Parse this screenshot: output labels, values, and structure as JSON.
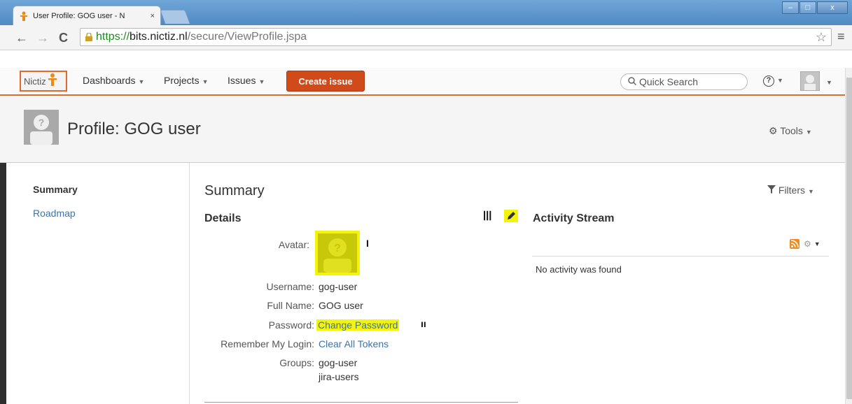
{
  "browser": {
    "tab_title": "User Profile: GOG user - N",
    "tab_close": "×",
    "url_scheme": "https://",
    "url_host": "bits.nictiz.nl",
    "url_path": "/secure/ViewProfile.jspa",
    "back": "←",
    "forward": "→",
    "reload": "C",
    "star": "☆",
    "menu": "≡",
    "win_min": "–",
    "win_max": "□",
    "win_close": "x"
  },
  "header": {
    "logo_text": "Nictiz",
    "nav": {
      "dashboards": "Dashboards",
      "projects": "Projects",
      "issues": "Issues"
    },
    "create_label": "Create issue",
    "search_placeholder": "Quick Search",
    "help": "?"
  },
  "profile": {
    "title": "Profile: GOG user",
    "tools_label": "Tools"
  },
  "sidebar": {
    "items": [
      {
        "label": "Summary",
        "active": true
      },
      {
        "label": "Roadmap",
        "active": false
      }
    ]
  },
  "main": {
    "title": "Summary",
    "filters_label": "Filters",
    "details_heading": "Details",
    "marks": {
      "edit": "ꟾꟾꟾ",
      "avatar": "I",
      "password": "ıı"
    },
    "fields": {
      "avatar_label": "Avatar:",
      "username_label": "Username:",
      "username": "gog-user",
      "fullname_label": "Full Name:",
      "fullname": "GOG user",
      "password_label": "Password:",
      "password_link": "Change Password",
      "remember_label": "Remember My Login:",
      "remember_link": "Clear All Tokens",
      "groups_label": "Groups:",
      "groups": [
        "gog-user",
        "jira-users"
      ]
    }
  },
  "activity": {
    "heading": "Activity Stream",
    "empty_text": "No activity was found"
  },
  "colors": {
    "accent": "#d04a1a",
    "link": "#3b73af",
    "highlight": "#f3f30c"
  }
}
